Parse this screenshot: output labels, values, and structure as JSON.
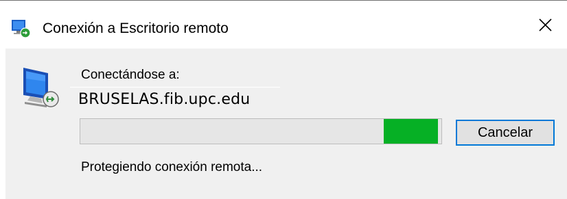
{
  "window": {
    "title": "Conexión a Escritorio remoto",
    "app_icon": "remote-desktop-icon",
    "close_icon": "close-icon"
  },
  "dialog": {
    "connecting_label": "Conectándose a:",
    "host": "BRUSELAS.fib.upc.edu",
    "progress": {
      "mode": "indeterminate",
      "segment_start_fraction": 0.84,
      "segment_end_fraction": 0.99,
      "color": "#06b025"
    },
    "cancel_label": "Cancelar",
    "status": "Protegiendo conexión remota...",
    "monitor_icon": "remote-desktop-monitor-icon"
  },
  "colors": {
    "dialog_background": "#f0f0f0",
    "focus_border": "#0078d7",
    "progress_green": "#06b025"
  }
}
